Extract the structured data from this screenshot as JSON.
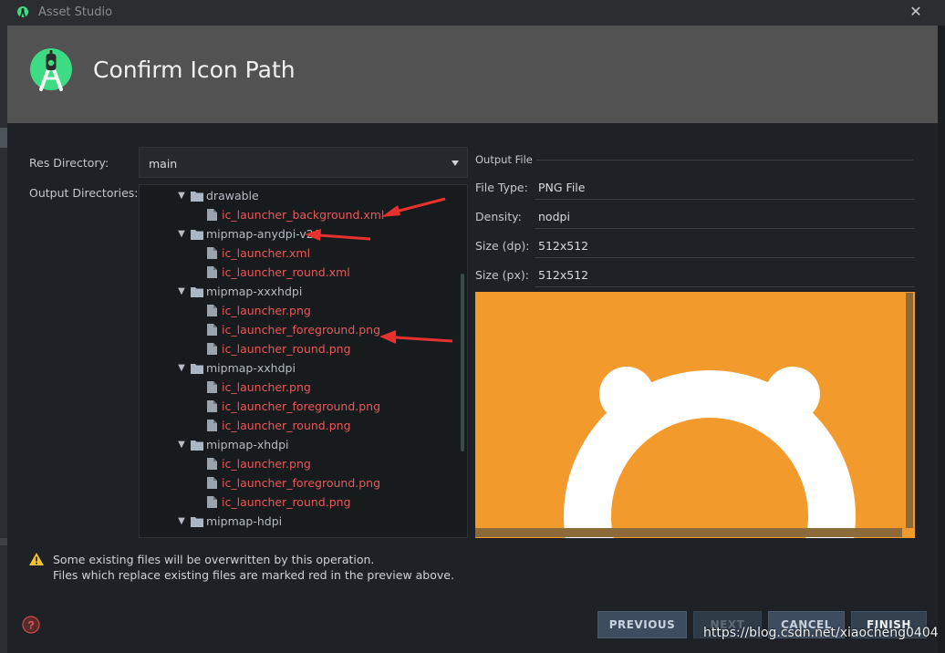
{
  "window": {
    "title": "Asset Studio"
  },
  "header": {
    "title": "Confirm Icon Path"
  },
  "form": {
    "res_directory_label": "Res Directory:",
    "res_directory_value": "main",
    "output_directories_label": "Output Directories:"
  },
  "tree": [
    {
      "type": "folder",
      "name": "drawable"
    },
    {
      "type": "file",
      "name": "ic_launcher_background.xml"
    },
    {
      "type": "folder",
      "name": "mipmap-anydpi-v26"
    },
    {
      "type": "file",
      "name": "ic_launcher.xml"
    },
    {
      "type": "file",
      "name": "ic_launcher_round.xml"
    },
    {
      "type": "folder",
      "name": "mipmap-xxxhdpi"
    },
    {
      "type": "file",
      "name": "ic_launcher.png"
    },
    {
      "type": "file",
      "name": "ic_launcher_foreground.png"
    },
    {
      "type": "file",
      "name": "ic_launcher_round.png"
    },
    {
      "type": "folder",
      "name": "mipmap-xxhdpi"
    },
    {
      "type": "file",
      "name": "ic_launcher.png"
    },
    {
      "type": "file",
      "name": "ic_launcher_foreground.png"
    },
    {
      "type": "file",
      "name": "ic_launcher_round.png"
    },
    {
      "type": "folder",
      "name": "mipmap-xhdpi"
    },
    {
      "type": "file",
      "name": "ic_launcher.png"
    },
    {
      "type": "file",
      "name": "ic_launcher_foreground.png"
    },
    {
      "type": "file",
      "name": "ic_launcher_round.png"
    },
    {
      "type": "folder",
      "name": "mipmap-hdpi"
    }
  ],
  "output": {
    "section_label": "Output File",
    "file_type_label": "File Type:",
    "file_type_value": "PNG File",
    "density_label": "Density:",
    "density_value": "nodpi",
    "size_dp_label": "Size (dp):",
    "size_dp_value": "512x512",
    "size_px_label": "Size (px):",
    "size_px_value": "512x512"
  },
  "warning": {
    "line1": "Some existing files will be overwritten by this operation.",
    "line2": "Files which replace existing files are marked red in the preview above."
  },
  "buttons": {
    "previous": "PREVIOUS",
    "next": "NEXT",
    "cancel": "CANCEL",
    "finish": "FINISH"
  },
  "watermark": "https://blog.csdn.net/xiaocheng0404",
  "colors": {
    "header_bg": "#525252",
    "existing_file": "#e85959",
    "preview_bg": "#f29a2c",
    "annotation_arrow": "#e8312f",
    "android_green": "#3ddc84"
  },
  "icons": [
    "android-studio-icon",
    "close-icon",
    "chevron-down-icon",
    "folder-icon",
    "file-icon",
    "warning-icon",
    "help-icon"
  ]
}
